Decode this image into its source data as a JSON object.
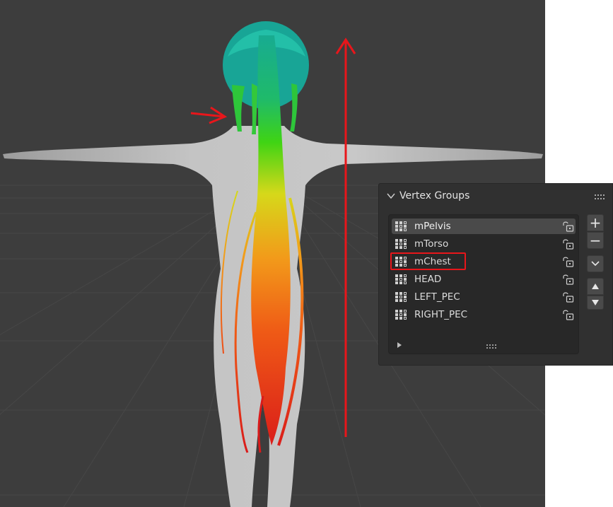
{
  "panel": {
    "title": "Vertex Groups",
    "groups": [
      {
        "label": "mPelvis",
        "active": true
      },
      {
        "label": "mTorso",
        "active": false
      },
      {
        "label": "mChest",
        "active": false
      },
      {
        "label": "HEAD",
        "active": false
      },
      {
        "label": "LEFT_PEC",
        "active": false
      },
      {
        "label": "RIGHT_PEC",
        "active": false
      }
    ],
    "buttons": {
      "add": "+",
      "remove": "−"
    }
  },
  "icons": {
    "panel_toggle": "chevron-down-icon",
    "group": "vertex-group-icon",
    "lock": "lock-open-icon",
    "specials": "chevron-down-icon",
    "move_up": "triangle-up-icon",
    "move_down": "triangle-down-icon",
    "expand_filter": "triangle-right-icon",
    "grip": "grip-dots-icon"
  },
  "colors": {
    "viewport_bg": "#3d3d3d",
    "panel_bg": "#303030",
    "list_bg": "#282828",
    "active_row": "#4a4a4a",
    "annotation_red": "#e8161b",
    "gradient_top": "#16a89a",
    "gradient_mid": "#2ed40f",
    "gradient_yellow": "#e8d81a",
    "gradient_orange": "#f0771a",
    "gradient_bottom": "#e61a1a",
    "body_gray": "#b9b9b9"
  }
}
